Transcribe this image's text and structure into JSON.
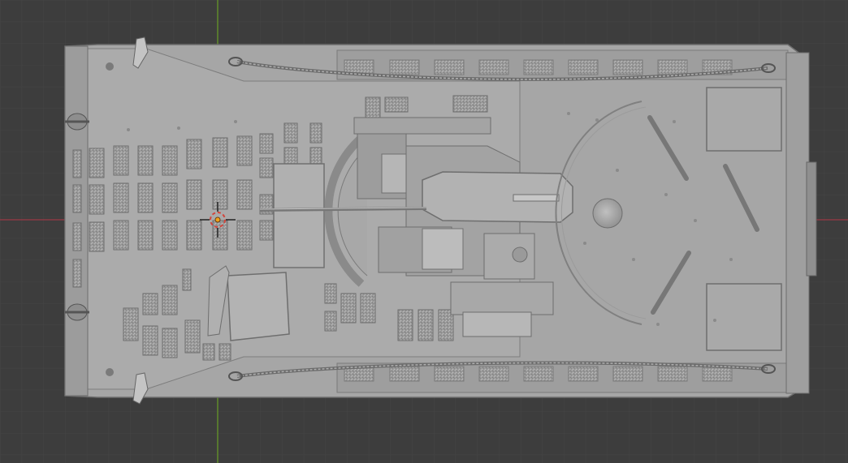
{
  "viewport": {
    "background": "#3d3d3d",
    "grid_minor_color": "#454545",
    "grid_major_color": "#4a4a4a",
    "x_axis_color": "#8c3a44",
    "y_axis_color": "#5f8a2a"
  },
  "model": {
    "name": "tracked-vehicle-top-view",
    "body_color": "#a9a9a9",
    "panel_color": "#b5b5b5",
    "shadow_color": "#8a8a8a",
    "dark_line_color": "#5a5a5a"
  },
  "cursor": {
    "icon": "3d-cursor-icon",
    "ring_color": "#d2453c",
    "dot_color": "#f0a21a"
  }
}
